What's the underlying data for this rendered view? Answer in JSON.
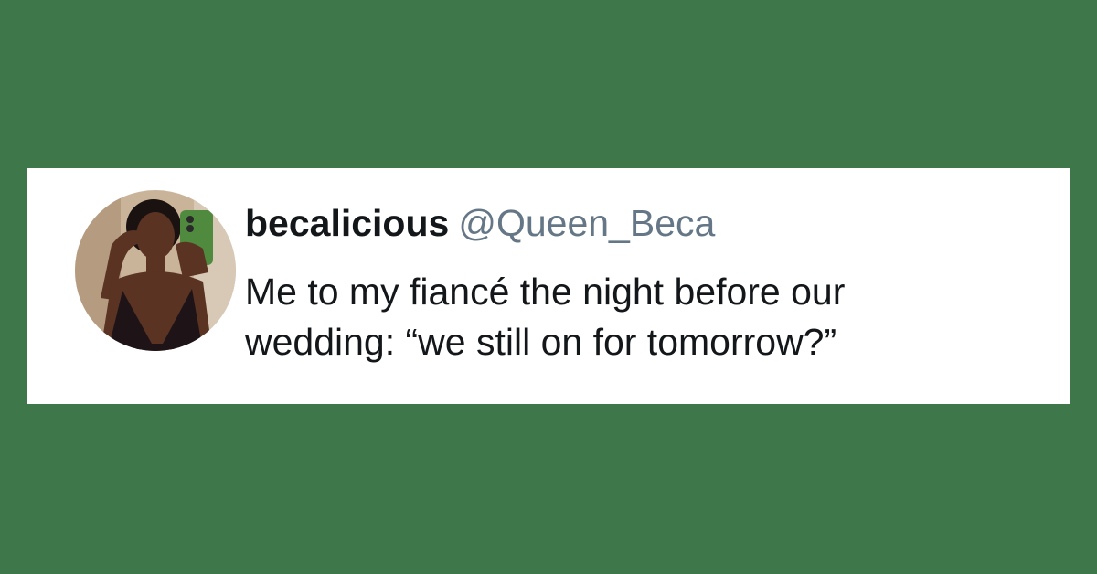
{
  "colors": {
    "background": "#3d774a",
    "card": "#ffffff",
    "name": "#14171a",
    "handle": "#657786",
    "text": "#14171a"
  },
  "tweet": {
    "avatar_icon": "profile-photo",
    "display_name": "becalicious",
    "handle": "@Queen_Beca",
    "text_lines": [
      "Me to my fiancé the night before our",
      "wedding: “we still on for tomorrow?”"
    ]
  }
}
